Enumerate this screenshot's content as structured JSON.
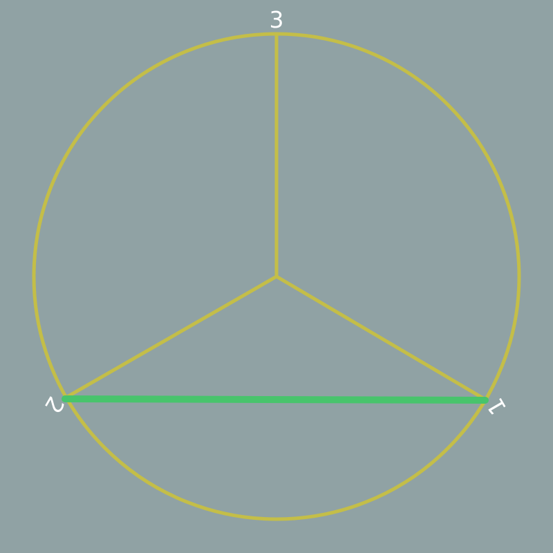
{
  "diagram": {
    "colors": {
      "background": "#90a2a4",
      "circle": "#c4be48",
      "spokes": "#c4be48",
      "chord": "#48c46c",
      "labels": "#ffffff"
    },
    "vertices": [
      {
        "id": "top",
        "label": "3"
      },
      {
        "id": "left",
        "label": "2"
      },
      {
        "id": "right",
        "label": "1"
      }
    ],
    "spokes": [
      "top",
      "left",
      "right"
    ],
    "highlighted_edge": [
      "left",
      "right"
    ]
  }
}
